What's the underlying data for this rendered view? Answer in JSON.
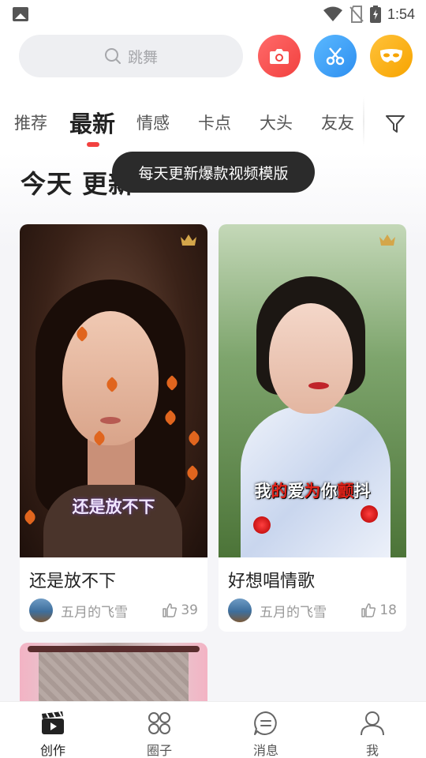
{
  "status_bar": {
    "time": "1:54"
  },
  "search": {
    "placeholder": "跳舞"
  },
  "tabs": [
    {
      "label": "推荐"
    },
    {
      "label": "最新",
      "active": true
    },
    {
      "label": "情感"
    },
    {
      "label": "卡点"
    },
    {
      "label": "大头"
    },
    {
      "label": "友友"
    }
  ],
  "section": {
    "title": "今天 更新"
  },
  "tooltip": {
    "text": "每天更新爆款视频模版"
  },
  "cards": [
    {
      "title": "还是放不下",
      "caption": "还是放不下",
      "author": "五月的飞雪",
      "likes": "39"
    },
    {
      "title": "好想唱情歌",
      "caption_parts": [
        "我",
        "的",
        "爱",
        "为",
        "你",
        "颤",
        "抖"
      ],
      "author": "五月的飞雪",
      "likes": "18"
    }
  ],
  "bottom_nav": [
    {
      "label": "创作",
      "icon": "clapperboard-icon",
      "active": true
    },
    {
      "label": "圈子",
      "icon": "grid-circles-icon"
    },
    {
      "label": "消息",
      "icon": "message-bubble-icon"
    },
    {
      "label": "我",
      "icon": "person-icon"
    }
  ],
  "colors": {
    "accent_red": "#f2413f",
    "camera_btn": "#f2413f",
    "scissors_btn": "#2e8ff0",
    "mask_btn": "#f7a400",
    "crown": "#d4a64a"
  }
}
